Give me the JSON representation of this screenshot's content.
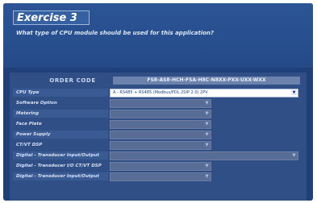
{
  "exercise": {
    "title": "Exercise 3",
    "question": "What type of CPU module should be used for this application?"
  },
  "order": {
    "label": "ORDER CODE",
    "value": "FS8-AS8-HCH-FSA-H8C-N8XX-PXX-UXX-WXX"
  },
  "rows": [
    {
      "label": "CPU Type",
      "value": "A - RS485 + RS485 (Modbus/PDL 2SIP 2.0) 2PV",
      "active": true
    },
    {
      "label": "Software Option",
      "value": "",
      "active": false
    },
    {
      "label": "Metering",
      "value": "",
      "active": false
    },
    {
      "label": "Face Plate",
      "value": "",
      "active": false
    },
    {
      "label": "Power Supply",
      "value": "",
      "active": false
    },
    {
      "label": "CT/VT DSP",
      "value": "",
      "active": false
    },
    {
      "label": "Digital - Transducer Input/Output",
      "value": "",
      "active": false
    },
    {
      "label": "Digital - Transducer I/O CT/VT DSP",
      "value": "",
      "active": false
    },
    {
      "label": "Digital - Transducer Input/Output",
      "value": "",
      "active": false
    }
  ],
  "icons": {
    "dropdown": "chevron-down-icon"
  },
  "colors": {
    "panel": "#1f3f78",
    "active_field": "#ffffff",
    "active_text": "#1c3f86"
  }
}
